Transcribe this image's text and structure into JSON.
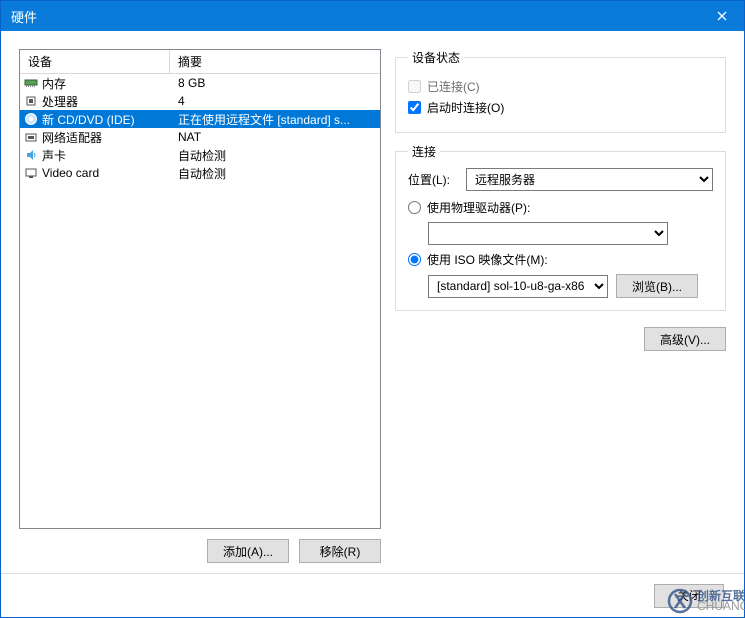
{
  "title": "硬件",
  "headers": {
    "device": "设备",
    "summary": "摘要"
  },
  "devices": [
    {
      "name": "内存",
      "summary": "8 GB",
      "icon": "memory"
    },
    {
      "name": "处理器",
      "summary": "4",
      "icon": "cpu"
    },
    {
      "name": "新 CD/DVD (IDE)",
      "summary": "正在使用远程文件 [standard] s...",
      "icon": "disc",
      "selected": true
    },
    {
      "name": "网络适配器",
      "summary": "NAT",
      "icon": "nic"
    },
    {
      "name": "声卡",
      "summary": "自动检测",
      "icon": "sound"
    },
    {
      "name": "Video card",
      "summary": "自动检测",
      "icon": "video"
    }
  ],
  "left_buttons": {
    "add": "添加(A)...",
    "remove": "移除(R)"
  },
  "status": {
    "legend": "设备状态",
    "connected_label": "已连接(C)",
    "connected_checked": false,
    "connected_enabled": false,
    "connect_on_start_label": "启动时连接(O)",
    "connect_on_start_checked": true
  },
  "connection": {
    "legend": "连接",
    "location_label": "位置(L):",
    "location_value": "远程服务器",
    "physical_label": "使用物理驱动器(P):",
    "physical_selected": false,
    "physical_drive_value": "",
    "iso_label": "使用 ISO 映像文件(M):",
    "iso_selected": true,
    "iso_file_value": "[standard] sol-10-u8-ga-x86",
    "browse_label": "浏览(B)..."
  },
  "advanced_label": "高级(V)...",
  "footer": {
    "close": "关闭"
  }
}
